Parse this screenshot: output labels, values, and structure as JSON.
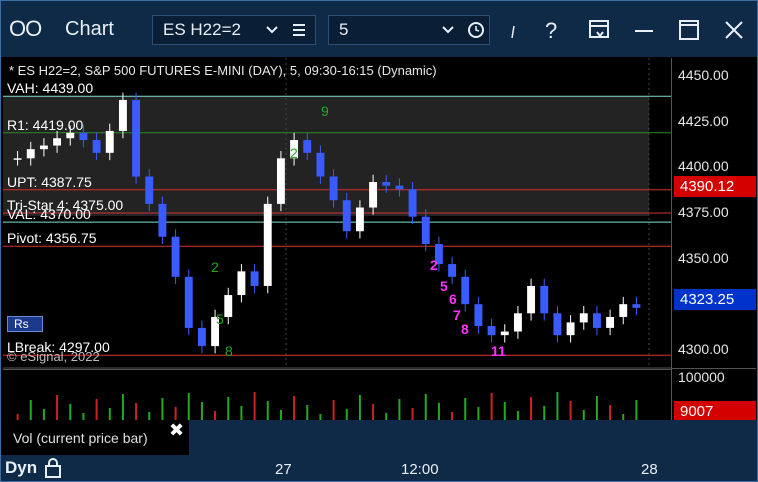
{
  "window": {
    "app_title": "Chart",
    "app_icon": "OO",
    "symbol": "ES H22=2",
    "interval": "5"
  },
  "chart_header": "* ES H22=2, S&P 500 FUTURES E-MINI (DAY), 5, 09:30-16:15 (Dynamic)",
  "levels": [
    {
      "label": "VAH: 4439.00",
      "price": 4439.0,
      "color": "#7fe0d0"
    },
    {
      "label": "R1: 4419.00",
      "price": 4419.0,
      "color": "#2a8a2a"
    },
    {
      "label": "UPT: 4387.75",
      "price": 4387.75,
      "color": "#d43030"
    },
    {
      "label": "Tri-Star 4: 4375.00",
      "price": 4375.0,
      "color": "#d43030"
    },
    {
      "label": "VAL: 4370.00",
      "price": 4370.0,
      "color": "#7fe0d0"
    },
    {
      "label": "Pivot: 4356.75",
      "price": 4356.75,
      "color": "#e03030"
    },
    {
      "label": "LBreak: 4297.00",
      "price": 4297.0,
      "color": "#e03030"
    }
  ],
  "copyright": "© eSignal, 2022",
  "price_axis": {
    "ticks": [
      "4450.00",
      "4425.00",
      "4400.00",
      "4375.00",
      "4350.00",
      "4325.00",
      "4300.00"
    ],
    "last_price": "4323.25",
    "marker_price": "4390.12",
    "marker_color": "#d40000",
    "last_color": "#0033cc"
  },
  "volume": {
    "tick": "100000",
    "current": "9007",
    "current_color": "#d40000"
  },
  "study_legend": "Vol (current price bar)",
  "time_axis": [
    "27",
    "12:00",
    "28"
  ],
  "bottom_bar": {
    "label": "Dyn"
  },
  "td_counts_magenta": [
    "2",
    "5",
    "6",
    "7",
    "8",
    "11"
  ],
  "td_counts_green": [
    "9",
    "2",
    "2",
    "5",
    "8"
  ],
  "chart_data": {
    "type": "candlestick",
    "title": "* ES H22=2, S&P 500 FUTURES E-MINI (DAY), 5, 09:30-16:15 (Dynamic)",
    "y_range": [
      4290,
      4460
    ],
    "x_ticks": [
      "27",
      "12:00",
      "28"
    ],
    "approximate_closes": [
      4405,
      4410,
      4412,
      4416,
      4419,
      4415,
      4408,
      4420,
      4437,
      4395,
      4380,
      4362,
      4340,
      4312,
      4302,
      4318,
      4330,
      4343,
      4335,
      4380,
      4405,
      4415,
      4408,
      4395,
      4382,
      4365,
      4378,
      4392,
      4390,
      4388,
      4373,
      4358,
      4347,
      4340,
      4325,
      4313,
      4308,
      4310,
      4320,
      4335,
      4320,
      4308,
      4315,
      4320,
      4312,
      4318,
      4325,
      4323
    ]
  }
}
